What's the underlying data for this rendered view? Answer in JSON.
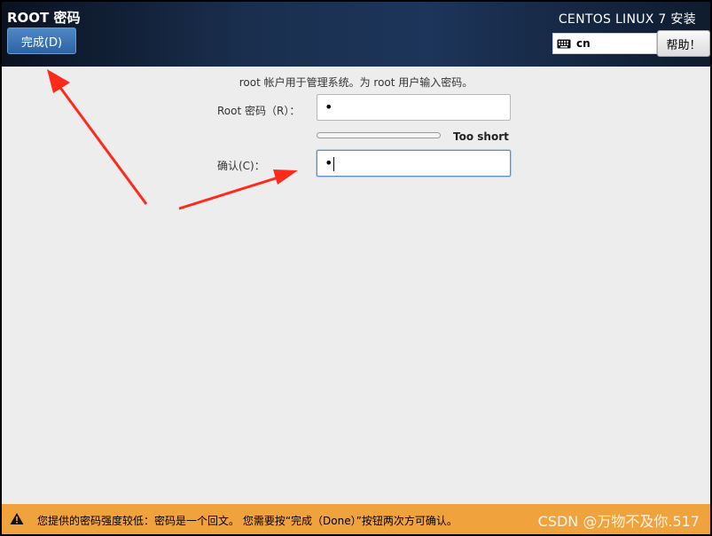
{
  "header": {
    "title": "ROOT 密码",
    "done_label": "完成(D)",
    "product": "CENTOS LINUX 7 安装",
    "keyboard_layout": "cn",
    "keyboard_icon": "keyboard-icon",
    "help_label": "帮助！"
  },
  "form": {
    "intro": "root 帐户用于管理系统。为 root 用户输入密码。",
    "root_label": "Root 密码（R）：",
    "root_value": "•",
    "strength_label": "Too short",
    "strength_level": 0.0,
    "confirm_label": "确认(C)：",
    "confirm_value": "•"
  },
  "warning": {
    "icon": "warning-icon",
    "text": "您提供的密码强度较低：密码是一个回文。 您需要按“完成（Done）”按钮两次方可确认。",
    "watermark": "CSDN @万物不及你.517"
  },
  "colors": {
    "header_bg": "#1d355a",
    "done_button": "#3a75b7",
    "warning_bar": "#f0a23c",
    "annotation_arrow": "#ff2a1a"
  }
}
